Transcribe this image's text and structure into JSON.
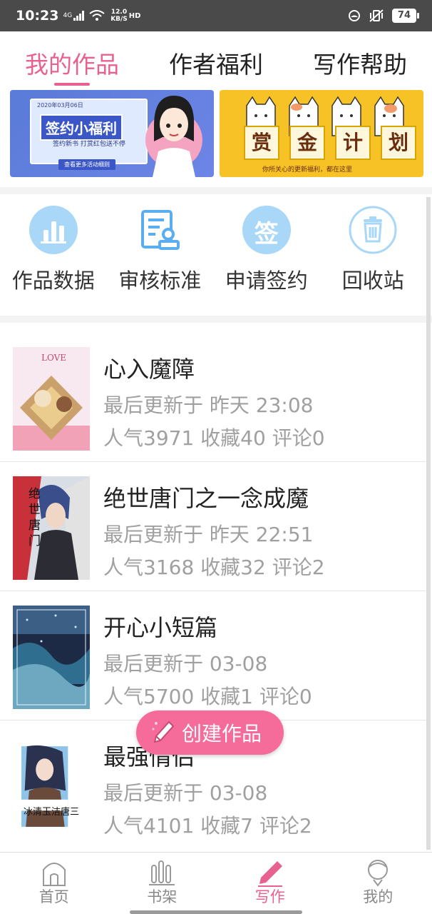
{
  "status_bar": {
    "time": "10:23",
    "network": "4G",
    "speed_value": "12.0",
    "speed_unit": "KB/S",
    "hd": "HD",
    "battery": "74"
  },
  "top_tabs": [
    {
      "label": "我的作品",
      "active": true
    },
    {
      "label": "作者福利",
      "active": false
    },
    {
      "label": "写作帮助",
      "active": false
    }
  ],
  "banners": {
    "left": {
      "date": "2020年03月06日",
      "title": "签约小福利",
      "subtitle": "签约新书 打赏红包送不停",
      "more": "查看更多活动细则"
    },
    "right": {
      "chars": [
        "赏",
        "金",
        "计",
        "划"
      ],
      "caption": "你所关心的更新福利，都在这里"
    }
  },
  "tools": [
    {
      "label": "作品数据",
      "icon": "bar-chart-icon"
    },
    {
      "label": "审核标准",
      "icon": "review-doc-icon"
    },
    {
      "label": "申请签约",
      "icon": "sign-icon",
      "glyph": "签"
    },
    {
      "label": "回收站",
      "icon": "trash-icon"
    }
  ],
  "works": [
    {
      "title": "心入魔障",
      "updated": "最后更新于 昨天 23:08",
      "stats": "人气3971 收藏40 评论0",
      "cover_text": "LOVE"
    },
    {
      "title": "绝世唐门之一念成魔",
      "updated": "最后更新于 昨天 22:51",
      "stats": "人气3168 收藏32 评论2",
      "cover_text": "绝世唐门"
    },
    {
      "title": "开心小短篇",
      "updated": "最后更新于 03-08",
      "stats": "人气5700 收藏1 评论0",
      "cover_text": ""
    },
    {
      "title": "最强情侣",
      "updated": "最后更新于 03-08",
      "stats": "人气4101 收藏7 评论2",
      "cover_text": "冰清玉洁唐三"
    }
  ],
  "fab": {
    "label": "创建作品",
    "icon": "pencil-icon"
  },
  "bottom_nav": [
    {
      "label": "首页",
      "icon": "home-icon",
      "active": false
    },
    {
      "label": "书架",
      "icon": "bookshelf-icon",
      "active": false
    },
    {
      "label": "写作",
      "icon": "write-icon",
      "active": true
    },
    {
      "label": "我的",
      "icon": "profile-icon",
      "active": false
    }
  ],
  "colors": {
    "accent": "#e8628f",
    "fab": "#f56b9a",
    "tool_icon": "#5aaef0",
    "muted_text": "#a0a0a0"
  }
}
